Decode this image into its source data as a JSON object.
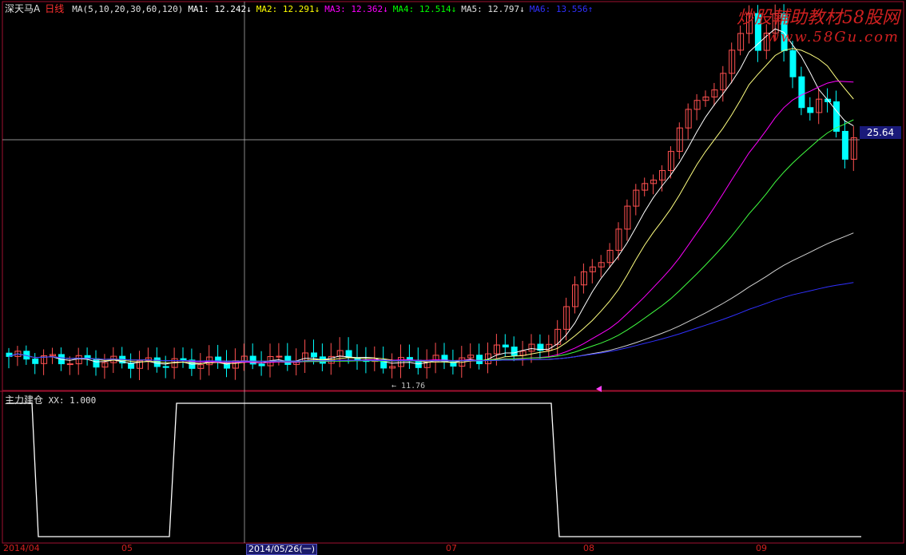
{
  "header": {
    "stock_name": "深天马A",
    "period": "日线",
    "ma_items": [
      {
        "text": "MA(5,10,20,30,60,120)",
        "color": "#e0e0e0"
      },
      {
        "text": "MA1: 12.242↓",
        "color": "#ffffff"
      },
      {
        "text": "MA2: 12.291↓",
        "color": "#ffff00"
      },
      {
        "text": "MA3: 12.362↓",
        "color": "#ff00ff"
      },
      {
        "text": "MA4: 12.514↓",
        "color": "#00ff00"
      },
      {
        "text": "MA5: 12.797↓",
        "color": "#e0e0e0"
      },
      {
        "text": "MA6: 13.556↑",
        "color": "#3030ff"
      }
    ]
  },
  "watermark": {
    "line1": "炒股輔助教材58股网",
    "line2": "www.58Gu.com"
  },
  "price_tag": "25.64",
  "low_label": "11.76",
  "sub_indicator": {
    "name": "主力建仓",
    "value_text": "XX: 1.000"
  },
  "date_axis": {
    "labels": [
      "2014/04",
      "05",
      "07",
      "08",
      "09"
    ],
    "cursor_label": "2014/05/26(一)"
  },
  "colors": {
    "up": "#ff5050",
    "down": "#00ffff",
    "frame": "#a01030",
    "crosshair": "#c0c0c0"
  }
}
